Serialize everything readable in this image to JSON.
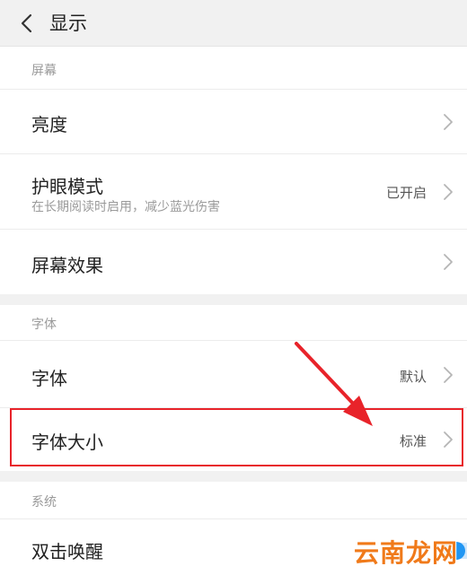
{
  "header": {
    "title": "显示",
    "back_icon": "chevron-left-icon"
  },
  "sections": [
    {
      "label": "屏幕",
      "rows": [
        {
          "label": "亮度",
          "value": "",
          "subtitle": ""
        },
        {
          "label": "护眼模式",
          "value": "已开启",
          "subtitle": "在长期阅读时启用，减少蓝光伤害"
        },
        {
          "label": "屏幕效果",
          "value": "",
          "subtitle": ""
        }
      ]
    },
    {
      "label": "字体",
      "rows": [
        {
          "label": "字体",
          "value": "默认",
          "subtitle": ""
        },
        {
          "label": "字体大小",
          "value": "标准",
          "subtitle": ""
        }
      ]
    },
    {
      "label": "系统",
      "rows": [
        {
          "label": "双击唤醒",
          "value": "",
          "subtitle": "",
          "toggle": true
        }
      ]
    }
  ],
  "annotation": {
    "highlight_color": "#e8232a",
    "highlighted_row": "字体大小"
  },
  "colors": {
    "toggle_on": "#2196f3",
    "watermark": "#f07a1a"
  },
  "watermark": "云南龙网"
}
